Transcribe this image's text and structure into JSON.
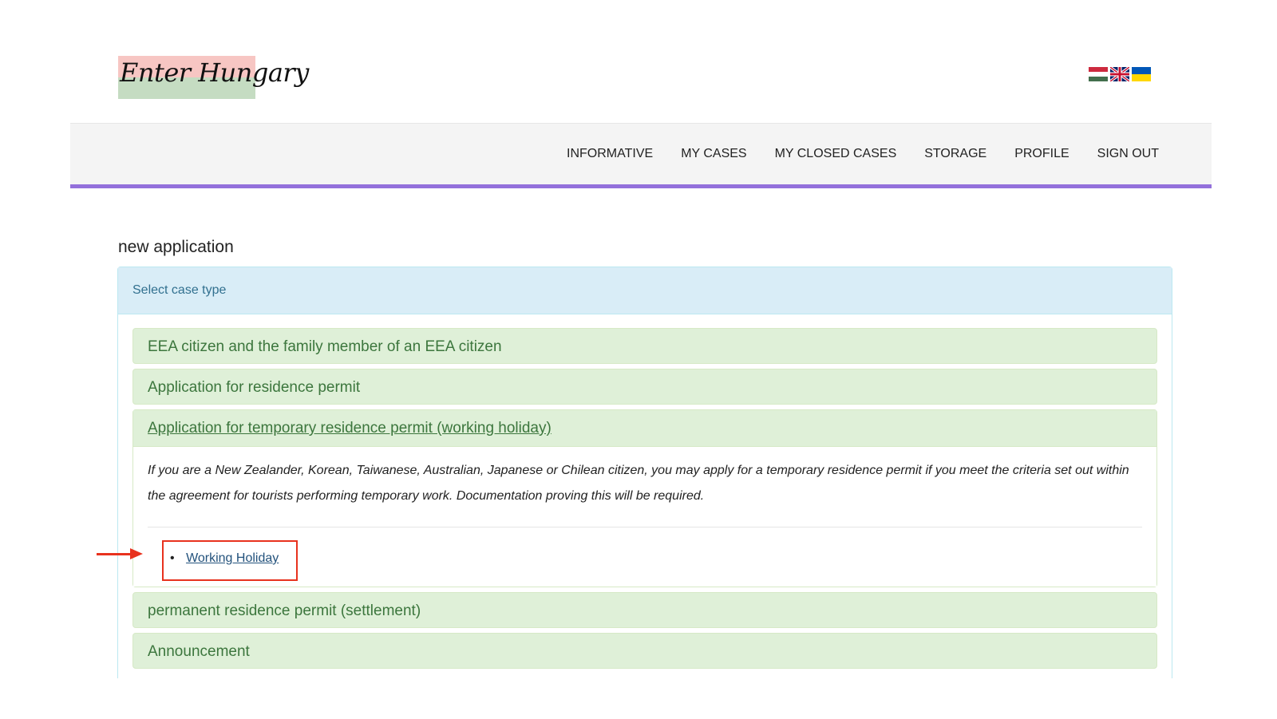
{
  "header": {
    "logo_text": "Enter Hungary",
    "language_flags": [
      {
        "name": "hungarian-flag-icon"
      },
      {
        "name": "english-flag-icon"
      },
      {
        "name": "ukrainian-flag-icon"
      }
    ]
  },
  "nav": {
    "items": [
      "INFORMATIVE",
      "MY CASES",
      "MY CLOSED CASES",
      "STORAGE",
      "PROFILE",
      "SIGN OUT"
    ]
  },
  "main": {
    "heading": "new application",
    "panel_title": "Select case type",
    "accordion": [
      {
        "label": "EEA citizen and the family member of an EEA citizen",
        "expanded": false
      },
      {
        "label": "Application for residence permit",
        "expanded": false
      },
      {
        "label": "Application for temporary residence permit (working holiday)",
        "expanded": true,
        "description": "If you are a New Zealander, Korean, Taiwanese, Australian, Japanese or Chilean citizen, you may apply for a temporary residence permit if you meet the criteria set out within the agreement for tourists performing temporary work. Documentation proving this will be required.",
        "links": [
          "Working Holiday"
        ]
      },
      {
        "label": "permanent residence permit (settlement)",
        "expanded": false
      },
      {
        "label": "Announcement",
        "expanded": false
      }
    ]
  },
  "colors": {
    "nav_accent": "#9370db",
    "panel_heading_bg": "#d9edf7",
    "accordion_bg": "#dff0d8",
    "accordion_text": "#3c763d",
    "annotation": "#e8321e"
  }
}
